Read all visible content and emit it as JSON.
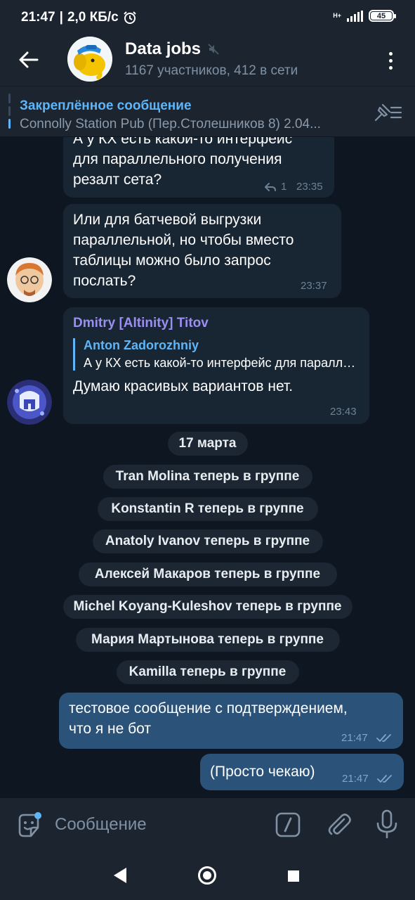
{
  "status_bar": {
    "time": "21:47",
    "speed": "2,0 КБ/с",
    "network": "H+",
    "battery": "45"
  },
  "header": {
    "title": "Data jobs",
    "subtitle": "1167 участников, 412 в сети"
  },
  "pinned": {
    "title": "Закреплённое сообщение",
    "text": "Connolly Station Pub (Пер.Столешников 8)  2.04..."
  },
  "messages": [
    {
      "lines": [
        "А у КХ есть какой-то интерфейс",
        "для параллельного получения",
        "резалт сета?"
      ],
      "replies": "1",
      "time": "23:35"
    },
    {
      "lines": [
        "Или для батчевой выгрузки",
        "параллельной, но чтобы вместо",
        "таблицы можно было запрос",
        "послать?"
      ],
      "time": "23:37"
    },
    {
      "sender": "Dmitry [Altinity] Titov",
      "quote_name": "Anton Zadorozhniy",
      "quote_text": "А у КХ есть какой-то интерфейс для параллельного получения резалт сета?",
      "text": "Думаю красивых вариантов нет.",
      "time": "23:43"
    }
  ],
  "date_divider": "17 марта",
  "service_messages": [
    "Tran Molina теперь в группе",
    "Konstantin R теперь в группе",
    "Anatoly Ivanov теперь в группе",
    "Алексей Макаров теперь в группе",
    "Michel Koyang-Kuleshov теперь в группе",
    "Мария Мартынова теперь в группе",
    "Kamilla теперь в группе"
  ],
  "outgoing": [
    {
      "lines": [
        "тестовое сообщение с подтверждением,",
        "что я не бот"
      ],
      "time": "21:47"
    },
    {
      "text": "(Просто чекаю)",
      "time": "21:47"
    }
  ],
  "input": {
    "placeholder": "Сообщение"
  },
  "colors": {
    "background": "#0e1621",
    "bar": "#1c242f",
    "incoming_bubble": "#182533",
    "outgoing_bubble": "#2b5278",
    "accent": "#5eb5f7",
    "sender_name": "#9b8ef0"
  },
  "icons": {
    "back": "arrow-left-icon",
    "muted": "mute-icon",
    "menu": "more-vertical-icon",
    "pin_list": "pin-list-icon",
    "reply_count": "reply-icon",
    "read": "double-check-icon",
    "emoji": "sticker-icon",
    "commands": "bot-command-icon",
    "attach": "paperclip-icon",
    "mic": "microphone-icon"
  }
}
